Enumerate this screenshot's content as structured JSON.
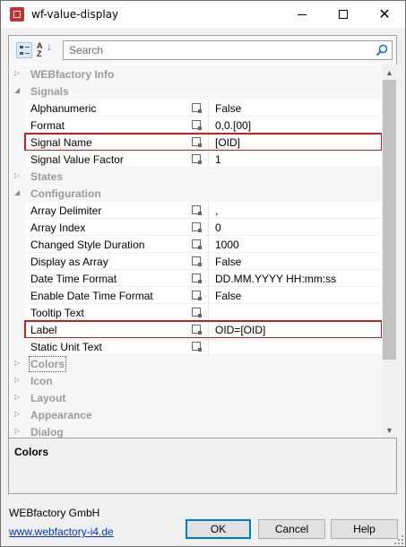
{
  "window": {
    "title": "wf-value-display"
  },
  "toolbar": {
    "search_placeholder": "Search",
    "categorized_icon": "categorized-view-icon",
    "alphabetical_icon": "alphabetical-sort-icon",
    "az_label": "A Z"
  },
  "grid": {
    "rows": [
      {
        "kind": "cat",
        "label": "WEBfactory Info",
        "expanded": false
      },
      {
        "kind": "cat",
        "label": "Signals",
        "expanded": true
      },
      {
        "kind": "prop",
        "name": "Alphanumeric",
        "value": "False"
      },
      {
        "kind": "prop",
        "name": "Format",
        "value": "0,0.[00]"
      },
      {
        "kind": "prop",
        "name": "Signal Name",
        "value": "[OID]",
        "highlight": true
      },
      {
        "kind": "prop",
        "name": "Signal Value Factor",
        "value": "1"
      },
      {
        "kind": "cat",
        "label": "States",
        "expanded": false
      },
      {
        "kind": "cat",
        "label": "Configuration",
        "expanded": true
      },
      {
        "kind": "prop",
        "name": "Array Delimiter",
        "value": ","
      },
      {
        "kind": "prop",
        "name": "Array Index",
        "value": "0"
      },
      {
        "kind": "prop",
        "name": "Changed Style Duration",
        "value": "1000"
      },
      {
        "kind": "prop",
        "name": "Display as Array",
        "value": "False"
      },
      {
        "kind": "prop",
        "name": "Date Time Format",
        "value": "DD.MM.YYYY HH:mm:ss"
      },
      {
        "kind": "prop",
        "name": "Enable Date Time Format",
        "value": "False"
      },
      {
        "kind": "prop",
        "name": "Tooltip Text",
        "value": ""
      },
      {
        "kind": "prop",
        "name": "Label",
        "value": "OID=[OID]",
        "highlight": true
      },
      {
        "kind": "prop",
        "name": "Static Unit Text",
        "value": ""
      },
      {
        "kind": "cat",
        "label": "Colors",
        "expanded": false,
        "selected": true
      },
      {
        "kind": "cat",
        "label": "Icon",
        "expanded": false
      },
      {
        "kind": "cat",
        "label": "Layout",
        "expanded": false
      },
      {
        "kind": "cat",
        "label": "Appearance",
        "expanded": false
      },
      {
        "kind": "cat",
        "label": "Dialog",
        "expanded": false
      }
    ]
  },
  "description": {
    "title": "Colors"
  },
  "footer": {
    "company": "WEBfactory GmbH",
    "link": "www.webfactory-i4.de",
    "ok_label": "OK",
    "cancel_label": "Cancel",
    "help_label": "Help"
  },
  "colors": {
    "highlight": "#c4201f",
    "link": "#0033cc",
    "default_button_border": "#0078d7"
  }
}
